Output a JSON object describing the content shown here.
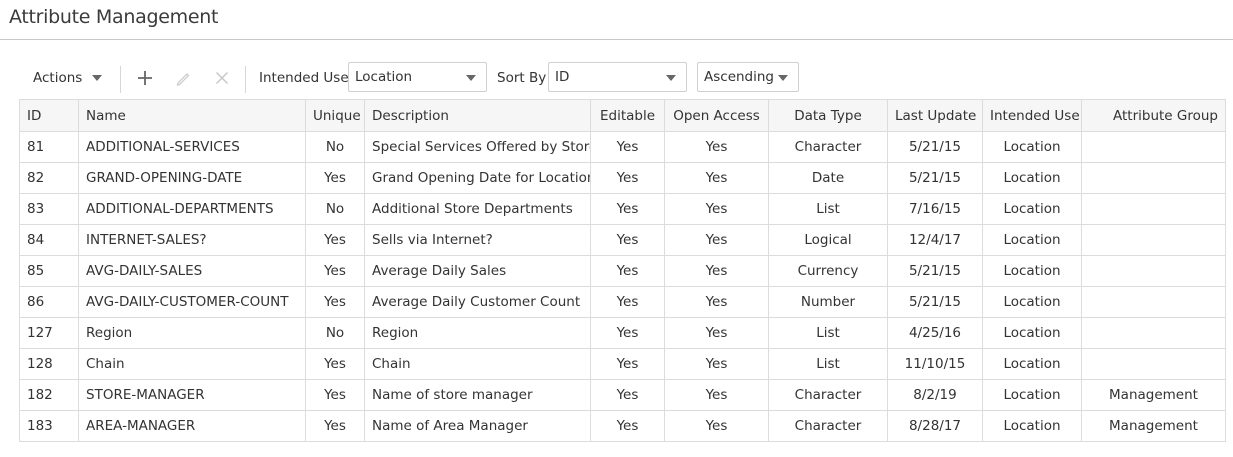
{
  "page": {
    "title": "Attribute Management"
  },
  "toolbar": {
    "actions_label": "Actions",
    "icons": [
      "add-icon",
      "edit-icon",
      "delete-icon"
    ],
    "intended_use_label": "Intended Use",
    "intended_use_value": "Location",
    "sort_by_label": "Sort By",
    "sort_by_value": "ID",
    "order_value": "Ascending"
  },
  "table": {
    "columns": [
      "ID",
      "Name",
      "Unique",
      "Description",
      "Editable",
      "Open Access",
      "Data Type",
      "Last Update",
      "Intended Use",
      "Attribute Group"
    ],
    "rows": [
      [
        "81",
        "ADDITIONAL-SERVICES",
        "No",
        "Special Services Offered by Store",
        "Yes",
        "Yes",
        "Character",
        "5/21/15",
        "Location",
        ""
      ],
      [
        "82",
        "GRAND-OPENING-DATE",
        "Yes",
        "Grand Opening Date for Location",
        "Yes",
        "Yes",
        "Date",
        "5/21/15",
        "Location",
        ""
      ],
      [
        "83",
        "ADDITIONAL-DEPARTMENTS",
        "No",
        "Additional Store Departments",
        "Yes",
        "Yes",
        "List",
        "7/16/15",
        "Location",
        ""
      ],
      [
        "84",
        "INTERNET-SALES?",
        "Yes",
        "Sells via Internet?",
        "Yes",
        "Yes",
        "Logical",
        "12/4/17",
        "Location",
        ""
      ],
      [
        "85",
        "AVG-DAILY-SALES",
        "Yes",
        "Average Daily Sales",
        "Yes",
        "Yes",
        "Currency",
        "5/21/15",
        "Location",
        ""
      ],
      [
        "86",
        "AVG-DAILY-CUSTOMER-COUNT",
        "Yes",
        "Average Daily Customer Count",
        "Yes",
        "Yes",
        "Number",
        "5/21/15",
        "Location",
        ""
      ],
      [
        "127",
        "Region",
        "No",
        "Region",
        "Yes",
        "Yes",
        "List",
        "4/25/16",
        "Location",
        ""
      ],
      [
        "128",
        "Chain",
        "Yes",
        "Chain",
        "Yes",
        "Yes",
        "List",
        "11/10/15",
        "Location",
        ""
      ],
      [
        "182",
        "STORE-MANAGER",
        "Yes",
        "Name of store manager",
        "Yes",
        "Yes",
        "Character",
        "8/2/19",
        "Location",
        "Management"
      ],
      [
        "183",
        "AREA-MANAGER",
        "Yes",
        "Name of Area Manager",
        "Yes",
        "Yes",
        "Character",
        "8/28/17",
        "Location",
        "Management"
      ]
    ]
  }
}
